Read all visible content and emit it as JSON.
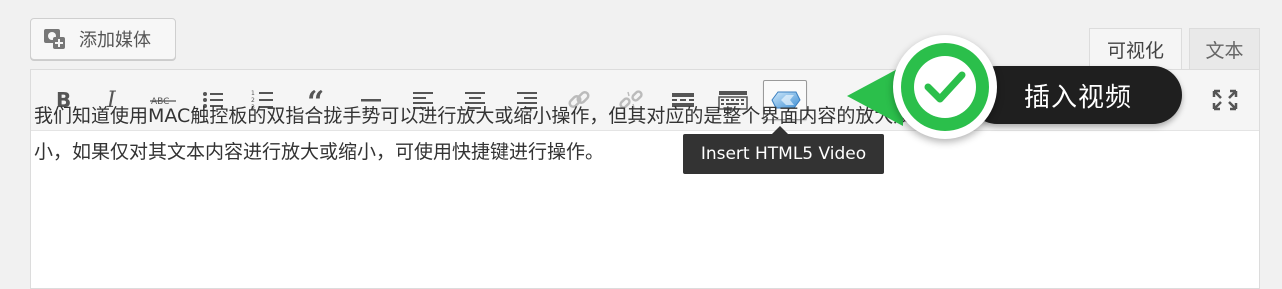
{
  "media_button": {
    "label": "添加媒体",
    "icon": "add-media-icon"
  },
  "tabs": {
    "visual": "可视化",
    "text": "文本"
  },
  "toolbar": {
    "buttons": [
      {
        "name": "bold-icon"
      },
      {
        "name": "italic-icon"
      },
      {
        "name": "strikethrough-icon",
        "glyph": "ABC"
      },
      {
        "name": "bullet-list-icon"
      },
      {
        "name": "numbered-list-icon"
      },
      {
        "name": "blockquote-icon"
      },
      {
        "name": "horizontal-line-icon"
      },
      {
        "name": "align-left-icon"
      },
      {
        "name": "align-center-icon"
      },
      {
        "name": "align-right-icon"
      },
      {
        "name": "link-icon"
      },
      {
        "name": "unlink-icon"
      },
      {
        "name": "insert-more-icon"
      },
      {
        "name": "toolbar-toggle-icon"
      },
      {
        "name": "html5-video-icon"
      },
      {
        "name": "fullscreen-icon"
      }
    ]
  },
  "tooltip": {
    "text": "Insert HTML5 Video"
  },
  "callout": {
    "label": "插入视频",
    "accent": "#2bbf4b"
  },
  "content": {
    "line1": "我们知道使用MAC触控板的双指合拢手势可以进行放大或缩小操作，但其对应的是整个界面内容的放大及缩",
    "line2": "小，如果仅对其文本内容进行放大或缩小，可使用快捷键进行操作。"
  }
}
